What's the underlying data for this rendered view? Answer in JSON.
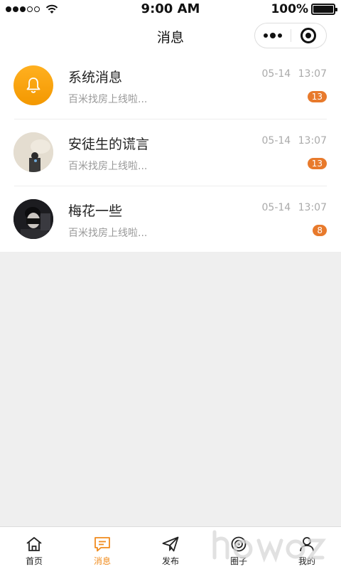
{
  "status_bar": {
    "time": "9:00 AM",
    "battery": "100%"
  },
  "nav": {
    "title": "消息"
  },
  "messages": [
    {
      "name": "系统消息",
      "preview": "百米找房上线啦...",
      "time": "05-14  13:07",
      "badge": "13",
      "avatar": "bell-icon"
    },
    {
      "name": "安徒生的谎言",
      "preview": "百米找房上线啦...",
      "time": "05-14  13:07",
      "badge": "13",
      "avatar": "user-photo"
    },
    {
      "name": "梅花一些",
      "preview": "百米找房上线啦...",
      "time": "05-14  13:07",
      "badge": "8",
      "avatar": "user-photo"
    }
  ],
  "tabs": [
    {
      "label": "首页",
      "icon": "home-icon",
      "active": false
    },
    {
      "label": "消息",
      "icon": "message-icon",
      "active": true
    },
    {
      "label": "发布",
      "icon": "send-icon",
      "active": false
    },
    {
      "label": "圈子",
      "icon": "circle-icon",
      "active": false
    },
    {
      "label": "我的",
      "icon": "user-icon",
      "active": false
    }
  ],
  "colors": {
    "accent": "#f08b1d",
    "badge": "#e87a2c",
    "background": "#efefef"
  }
}
